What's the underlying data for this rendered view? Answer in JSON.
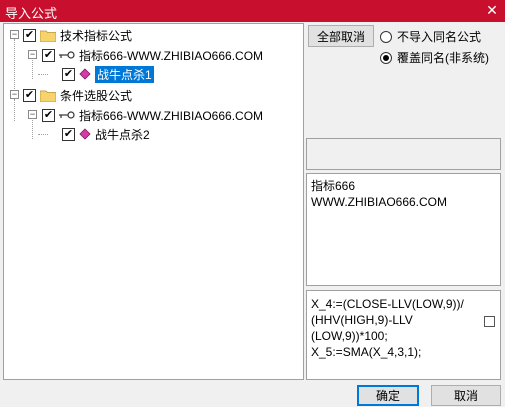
{
  "window": {
    "title": "导入公式",
    "close_glyph": "✕",
    "accent": "#c8102e"
  },
  "tree": {
    "check_glyph": "✔",
    "collapse_glyph": "−",
    "nodes": [
      {
        "label": "技术指标公式",
        "checked": true,
        "icon": "folder-icon"
      },
      {
        "label": "指标666-WWW.ZHIBIAO666.COM",
        "checked": true,
        "icon": "key-icon"
      },
      {
        "label": "战牛点杀1",
        "checked": true,
        "icon": "formula-icon",
        "selected": true
      },
      {
        "label": "条件选股公式",
        "checked": true,
        "icon": "folder-icon"
      },
      {
        "label": "指标666-WWW.ZHIBIAO666.COM",
        "checked": true,
        "icon": "key-icon"
      },
      {
        "label": "战牛点杀2",
        "checked": true,
        "icon": "formula-icon"
      }
    ]
  },
  "options": {
    "cancel_all_label": "全部取消",
    "radio_no_import": "不导入同名公式",
    "radio_overwrite": "覆盖同名(非系统)",
    "selected_radio": "overwrite"
  },
  "info": {
    "line1": "指标666",
    "line2": "WWW.ZHIBIAO666.COM"
  },
  "formula": {
    "text": "X_4:=(CLOSE-LLV(LOW,9))/\n(HHV(HIGH,9)-LLV\n(LOW,9))*100;\nX_5:=SMA(X_4,3,1);"
  },
  "footer": {
    "ok_label": "确定",
    "cancel_label": "取消"
  },
  "colors": {
    "selection": "#0078d7",
    "folder": "#f6d36b",
    "formula_icon": "#d63aa6"
  }
}
